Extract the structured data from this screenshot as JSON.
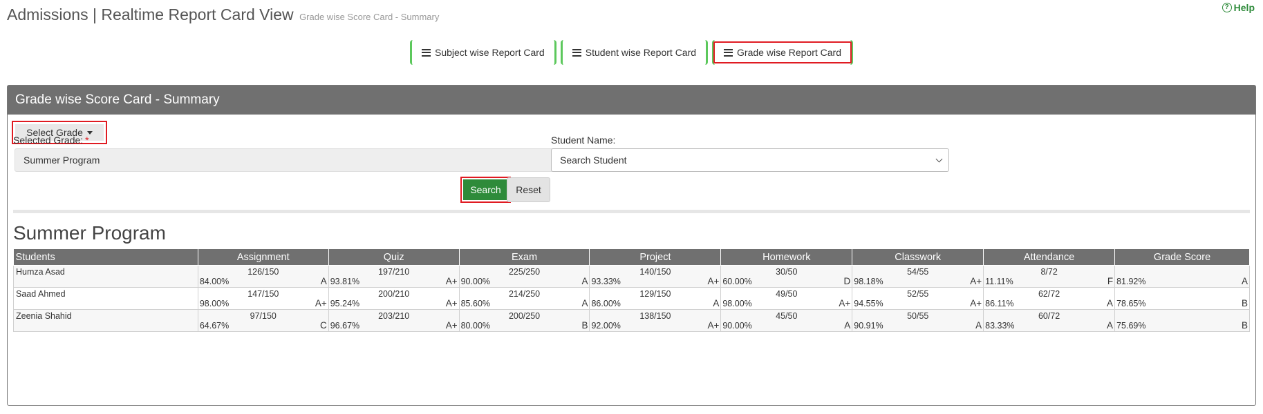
{
  "header": {
    "title": "Admissions | Realtime Report Card View",
    "subtitle": "Grade wise Score Card - Summary",
    "help_label": "Help"
  },
  "tabs": [
    {
      "label": "Subject wise Report Card"
    },
    {
      "label": "Student wise Report Card"
    },
    {
      "label": "Grade wise Report Card"
    }
  ],
  "panel": {
    "title": "Grade wise Score Card - Summary",
    "select_grade_label": "Select Grade",
    "selected_grade_label": "Selected Grade:",
    "required_mark": "*",
    "selected_grade_value": "Summer Program",
    "student_name_label": "Student Name:",
    "student_name_value": "Search Student",
    "search_label": "Search",
    "reset_label": "Reset"
  },
  "report": {
    "title": "Summer Program",
    "columns": [
      "Students",
      "Assignment",
      "Quiz",
      "Exam",
      "Project",
      "Homework",
      "Classwork",
      "Attendance",
      "Grade Score"
    ],
    "rows": [
      {
        "name": "Humza Asad",
        "cells": [
          {
            "score": "126/150",
            "pct": "84.00%",
            "grade": "A"
          },
          {
            "score": "197/210",
            "pct": "93.81%",
            "grade": "A+"
          },
          {
            "score": "225/250",
            "pct": "90.00%",
            "grade": "A"
          },
          {
            "score": "140/150",
            "pct": "93.33%",
            "grade": "A+"
          },
          {
            "score": "30/50",
            "pct": "60.00%",
            "grade": "D"
          },
          {
            "score": "54/55",
            "pct": "98.18%",
            "grade": "A+"
          },
          {
            "score": "8/72",
            "pct": "11.11%",
            "grade": "F"
          },
          {
            "score": "",
            "pct": "81.92%",
            "grade": "A"
          }
        ]
      },
      {
        "name": "Saad Ahmed",
        "cells": [
          {
            "score": "147/150",
            "pct": "98.00%",
            "grade": "A+"
          },
          {
            "score": "200/210",
            "pct": "95.24%",
            "grade": "A+"
          },
          {
            "score": "214/250",
            "pct": "85.60%",
            "grade": "A"
          },
          {
            "score": "129/150",
            "pct": "86.00%",
            "grade": "A"
          },
          {
            "score": "49/50",
            "pct": "98.00%",
            "grade": "A+"
          },
          {
            "score": "52/55",
            "pct": "94.55%",
            "grade": "A+"
          },
          {
            "score": "62/72",
            "pct": "86.11%",
            "grade": "A"
          },
          {
            "score": "",
            "pct": "78.65%",
            "grade": "B"
          }
        ]
      },
      {
        "name": "Zeenia Shahid",
        "cells": [
          {
            "score": "97/150",
            "pct": "64.67%",
            "grade": "C"
          },
          {
            "score": "203/210",
            "pct": "96.67%",
            "grade": "A+"
          },
          {
            "score": "200/250",
            "pct": "80.00%",
            "grade": "B"
          },
          {
            "score": "138/150",
            "pct": "92.00%",
            "grade": "A+"
          },
          {
            "score": "45/50",
            "pct": "90.00%",
            "grade": "A"
          },
          {
            "score": "50/55",
            "pct": "90.91%",
            "grade": "A"
          },
          {
            "score": "60/72",
            "pct": "83.33%",
            "grade": "A"
          },
          {
            "score": "",
            "pct": "75.69%",
            "grade": "B"
          }
        ]
      }
    ]
  }
}
